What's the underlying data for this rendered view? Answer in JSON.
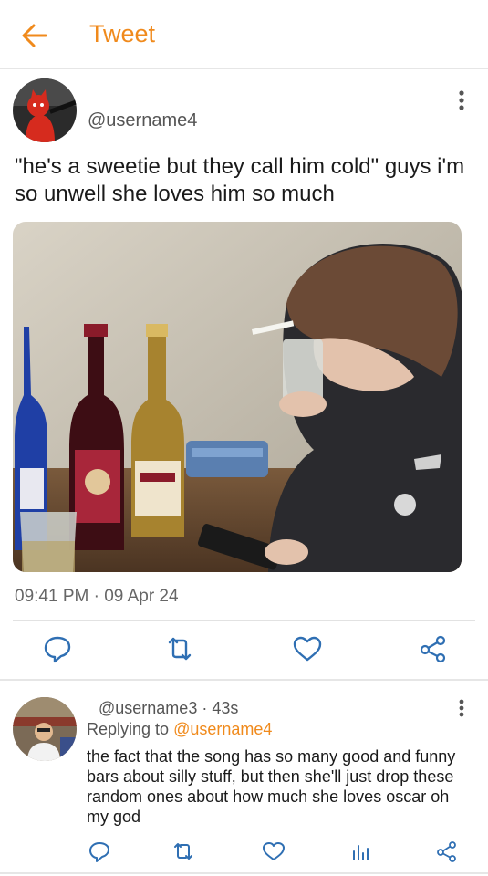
{
  "header": {
    "title": "Tweet"
  },
  "tweet": {
    "handle": "@username4",
    "text": "\"he's a sweetie but they call him cold\" guys i'm so unwell she loves him so much",
    "time": "09:41 PM",
    "date_sep": " · ",
    "date": "09 Apr 24"
  },
  "reply": {
    "handle": "@username3",
    "age_sep": " · ",
    "age": "43s",
    "replying_prefix": "Replying to ",
    "replying_to": "@username4",
    "text": "the fact that the song has so many good and funny bars about silly stuff, but then she'll just drop these random ones about how much she loves oscar oh my god"
  },
  "colors": {
    "accent": "#f08a1c",
    "icon": "#2f6fb3",
    "muted": "#666666"
  },
  "icons": [
    "back-arrow-icon",
    "more-vertical-icon",
    "reply-icon",
    "retweet-icon",
    "like-icon",
    "share-icon",
    "analytics-icon"
  ]
}
